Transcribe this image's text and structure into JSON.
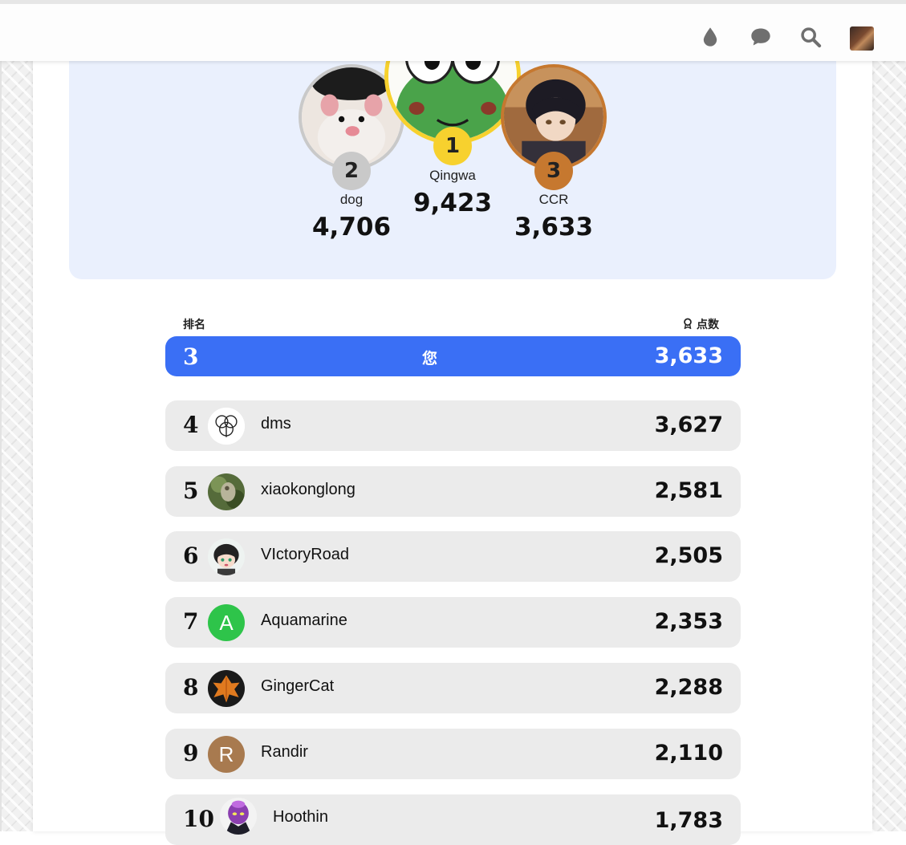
{
  "header": {
    "icons": [
      "drop-icon",
      "chat-bubble-icon",
      "search-icon",
      "user-avatar"
    ]
  },
  "podium": {
    "first": {
      "rank": "1",
      "name": "Qingwa",
      "score": "9,423",
      "badge_color": "#f7d12e"
    },
    "second": {
      "rank": "2",
      "name": "dog",
      "score": "4,706",
      "badge_color": "#c9c9c9"
    },
    "third": {
      "rank": "3",
      "name": "CCR",
      "score": "3,633",
      "badge_color": "#c6782f"
    }
  },
  "table": {
    "rank_header": "排名",
    "points_header": "点数",
    "you": {
      "rank": "3",
      "label": "您",
      "score": "3,633"
    },
    "rows": [
      {
        "rank": "4",
        "name": "dms",
        "score": "3,627",
        "avatar_letter": ""
      },
      {
        "rank": "5",
        "name": "xiaokonglong",
        "score": "2,581",
        "avatar_letter": ""
      },
      {
        "rank": "6",
        "name": "VIctoryRoad",
        "score": "2,505",
        "avatar_letter": ""
      },
      {
        "rank": "7",
        "name": "Aquamarine",
        "score": "2,353",
        "avatar_letter": "A"
      },
      {
        "rank": "8",
        "name": "GingerCat",
        "score": "2,288",
        "avatar_letter": ""
      },
      {
        "rank": "9",
        "name": "Randir",
        "score": "2,110",
        "avatar_letter": "R"
      },
      {
        "rank": "10",
        "name": "Hoothin",
        "score": "1,783",
        "avatar_letter": ""
      }
    ]
  },
  "colors": {
    "accent": "#3a6ff5",
    "panel": "#eaf0fd",
    "row_bg": "#ebebeb",
    "avatar_aquamarine": "#2ec44a",
    "avatar_randir": "#a87a4f"
  }
}
